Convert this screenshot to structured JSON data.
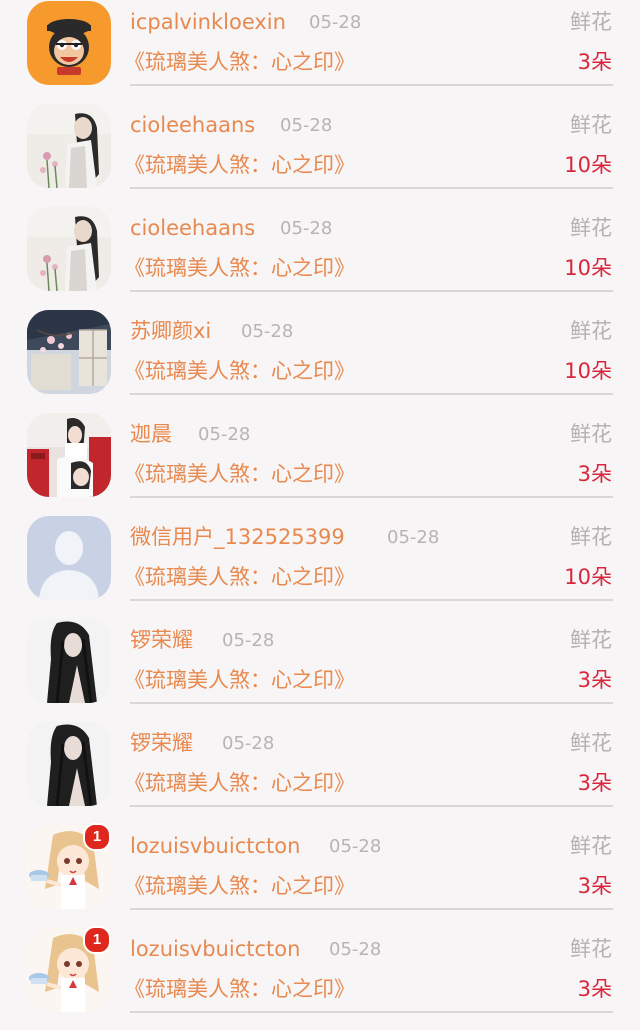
{
  "records": [
    {
      "username": "icpalvinkloexin",
      "date": "05-28",
      "gift_type": "鲜花",
      "book": "《琉璃美人煞：心之印》",
      "count": "3朵",
      "avatar_icon": "monkey-logo-avatar"
    },
    {
      "username": "cioleehaans",
      "date": "05-28",
      "gift_type": "鲜花",
      "book": "《琉璃美人煞：心之印》",
      "count": "10朵",
      "avatar_icon": "girl-flowers-avatar"
    },
    {
      "username": "cioleehaans",
      "date": "05-28",
      "gift_type": "鲜花",
      "book": "《琉璃美人煞：心之印》",
      "count": "10朵",
      "avatar_icon": "girl-flowers-avatar"
    },
    {
      "username": "苏卿颜xi",
      "date": "05-28",
      "gift_type": "鲜花",
      "book": "《琉璃美人煞：心之印》",
      "count": "10朵",
      "avatar_icon": "blossom-window-avatar"
    },
    {
      "username": "迦晨",
      "date": "05-28",
      "gift_type": "鲜花",
      "book": "《琉璃美人煞：心之印》",
      "count": "3朵",
      "avatar_icon": "girl-red-avatar"
    },
    {
      "username": "微信用户_132525399",
      "date": "05-28",
      "gift_type": "鲜花",
      "book": "《琉璃美人煞：心之印》",
      "count": "10朵",
      "avatar_icon": "default-user-avatar"
    },
    {
      "username": "锣荣耀",
      "date": "05-28",
      "gift_type": "鲜花",
      "book": "《琉璃美人煞：心之印》",
      "count": "3朵",
      "avatar_icon": "dark-hair-girl-avatar"
    },
    {
      "username": "锣荣耀",
      "date": "05-28",
      "gift_type": "鲜花",
      "book": "《琉璃美人煞：心之印》",
      "count": "3朵",
      "avatar_icon": "dark-hair-girl-avatar"
    },
    {
      "username": "lozuisvbuictcton",
      "date": "05-28",
      "gift_type": "鲜花",
      "book": "《琉璃美人煞：心之印》",
      "count": "3朵",
      "avatar_icon": "anime-girl-avatar",
      "badge": "1"
    },
    {
      "username": "lozuisvbuictcton",
      "date": "05-28",
      "gift_type": "鲜花",
      "book": "《琉璃美人煞：心之印》",
      "count": "3朵",
      "avatar_icon": "anime-girl-avatar",
      "badge": "1"
    }
  ],
  "colors": {
    "username": "#e8894f",
    "date": "#b9b3b3",
    "gift_type": "#b7b1b1",
    "book": "#e8894f",
    "count": "#d9263e",
    "badge": "#e0271d",
    "background": "#f7f5f5"
  }
}
